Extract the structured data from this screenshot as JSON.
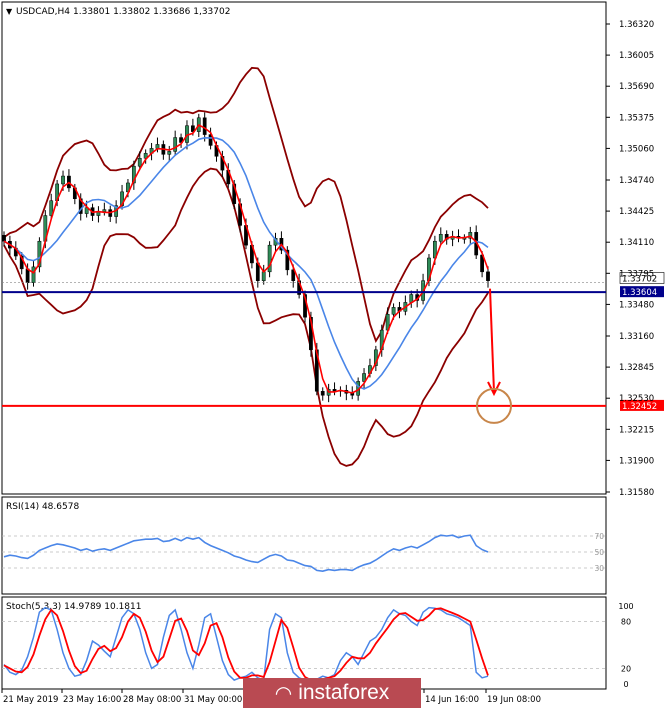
{
  "header": {
    "dropdown_glyph": "▼",
    "symbol": "USDCAD,H4",
    "ohlc": "1.33801 1.33802 1.33686 1,33702"
  },
  "watermark": {
    "text": "instaforex"
  },
  "chart_data": [
    {
      "type": "candlestick",
      "title": "USDCAD,H4",
      "price_scale": [
        "1.36320",
        "1.36005",
        "1.35690",
        "1.35375",
        "1.35060",
        "1.34740",
        "1.34425",
        "1.34110",
        "1.33795",
        "1.33480",
        "1.33160",
        "1.32845",
        "1.32530",
        "1.32215",
        "1.31900",
        "1.31580"
      ],
      "ylim": [
        1.3158,
        1.3632
      ],
      "x_labels": [
        "21 May 2019",
        "23 May 16:00",
        "28 May 08:00",
        "31 May 00:00",
        "14 Jun 16:00",
        "19 Jun 08:00"
      ],
      "current_price": {
        "label": "1.33702",
        "value": 1.33702
      },
      "levels": [
        {
          "label": "1.33604",
          "value": 1.33604,
          "color": "#00008b"
        },
        {
          "label": "1.32452",
          "value": 1.32452,
          "color": "#ff0000"
        }
      ],
      "close": [
        1.3412,
        1.3405,
        1.3397,
        1.3384,
        1.337,
        1.3386,
        1.3412,
        1.3438,
        1.3453,
        1.347,
        1.3478,
        1.3466,
        1.3455,
        1.344,
        1.3446,
        1.3438,
        1.3442,
        1.3444,
        1.3437,
        1.3448,
        1.3462,
        1.3471,
        1.3488,
        1.3496,
        1.3501,
        1.3506,
        1.351,
        1.35,
        1.3503,
        1.3517,
        1.3512,
        1.3529,
        1.3523,
        1.3537,
        1.352,
        1.3509,
        1.3498,
        1.3484,
        1.347,
        1.345,
        1.3428,
        1.3408,
        1.339,
        1.3372,
        1.3381,
        1.3408,
        1.3415,
        1.3403,
        1.3383,
        1.3372,
        1.3358,
        1.3335,
        1.3302,
        1.326,
        1.3256,
        1.3262,
        1.326,
        1.3261,
        1.3258,
        1.3256,
        1.327,
        1.3278,
        1.3286,
        1.3302,
        1.3322,
        1.3338,
        1.3345,
        1.3341,
        1.335,
        1.3358,
        1.3352,
        1.3372,
        1.3395,
        1.3412,
        1.3419,
        1.3414,
        1.3417,
        1.3415,
        1.3415,
        1.3421,
        1.3398,
        1.3381,
        1.3372
      ],
      "series": [
        {
          "name": "Bollinger Bands",
          "color": "#8b0000"
        },
        {
          "name": "MA fast",
          "color": "#ff0000"
        },
        {
          "name": "MA slow",
          "color": "#4a86e8"
        }
      ],
      "forecast": {
        "arrow_color": "#ff0000",
        "target": 1.32452,
        "circle_color": "#c8864a"
      }
    },
    {
      "type": "line",
      "title": "RSI(14) 48.6578",
      "ylim": [
        0,
        100
      ],
      "levels": [
        70,
        50,
        30
      ],
      "level_labels": [
        "70",
        "50",
        "30"
      ],
      "color": "#4a86e8",
      "values": [
        44,
        46,
        45,
        43,
        42,
        46,
        52,
        55,
        58,
        60,
        59,
        57,
        55,
        52,
        54,
        51,
        53,
        54,
        52,
        55,
        58,
        61,
        64,
        65,
        66,
        66,
        67,
        63,
        64,
        67,
        64,
        68,
        66,
        68,
        62,
        58,
        55,
        52,
        49,
        45,
        43,
        40,
        38,
        37,
        41,
        45,
        47,
        45,
        40,
        39,
        36,
        33,
        32,
        27,
        26,
        28,
        27,
        28,
        28,
        27,
        31,
        34,
        36,
        40,
        45,
        50,
        54,
        52,
        55,
        57,
        55,
        59,
        63,
        68,
        71,
        70,
        71,
        68,
        70,
        71,
        58,
        53,
        50
      ]
    },
    {
      "type": "line",
      "title": "Stoch(5,3,3) 14.9789 10.1811",
      "ylim": [
        0,
        100
      ],
      "levels": [
        80,
        20
      ],
      "level_labels": [
        "100",
        "80",
        "20",
        "0"
      ],
      "series": [
        {
          "name": "main",
          "color": "#4a86e8",
          "values": [
            25,
            15,
            12,
            18,
            35,
            60,
            92,
            98,
            95,
            70,
            40,
            20,
            10,
            12,
            30,
            55,
            50,
            42,
            35,
            60,
            85,
            95,
            90,
            70,
            40,
            20,
            25,
            60,
            88,
            95,
            70,
            40,
            20,
            50,
            85,
            90,
            60,
            30,
            12,
            5,
            8,
            10,
            15,
            8,
            5,
            70,
            90,
            85,
            40,
            15,
            8,
            5,
            3,
            6,
            10,
            8,
            12,
            30,
            40,
            35,
            25,
            40,
            55,
            60,
            70,
            85,
            95,
            90,
            88,
            80,
            75,
            92,
            98,
            97,
            95,
            90,
            88,
            85,
            80,
            75,
            15,
            8,
            10
          ]
        },
        {
          "name": "signal",
          "color": "#ff0000",
          "values": [
            24,
            20,
            16,
            15,
            22,
            38,
            62,
            83,
            95,
            88,
            68,
            43,
            23,
            14,
            17,
            32,
            45,
            49,
            42,
            46,
            60,
            80,
            90,
            85,
            67,
            43,
            28,
            35,
            58,
            81,
            84,
            68,
            43,
            37,
            52,
            75,
            78,
            60,
            34,
            16,
            8,
            8,
            11,
            11,
            9,
            28,
            55,
            82,
            72,
            47,
            21,
            9,
            5,
            5,
            6,
            8,
            10,
            17,
            27,
            35,
            33,
            33,
            40,
            52,
            62,
            72,
            83,
            90,
            91,
            86,
            81,
            82,
            88,
            96,
            97,
            94,
            91,
            88,
            84,
            80,
            57,
            33,
            11
          ]
        }
      ]
    }
  ]
}
